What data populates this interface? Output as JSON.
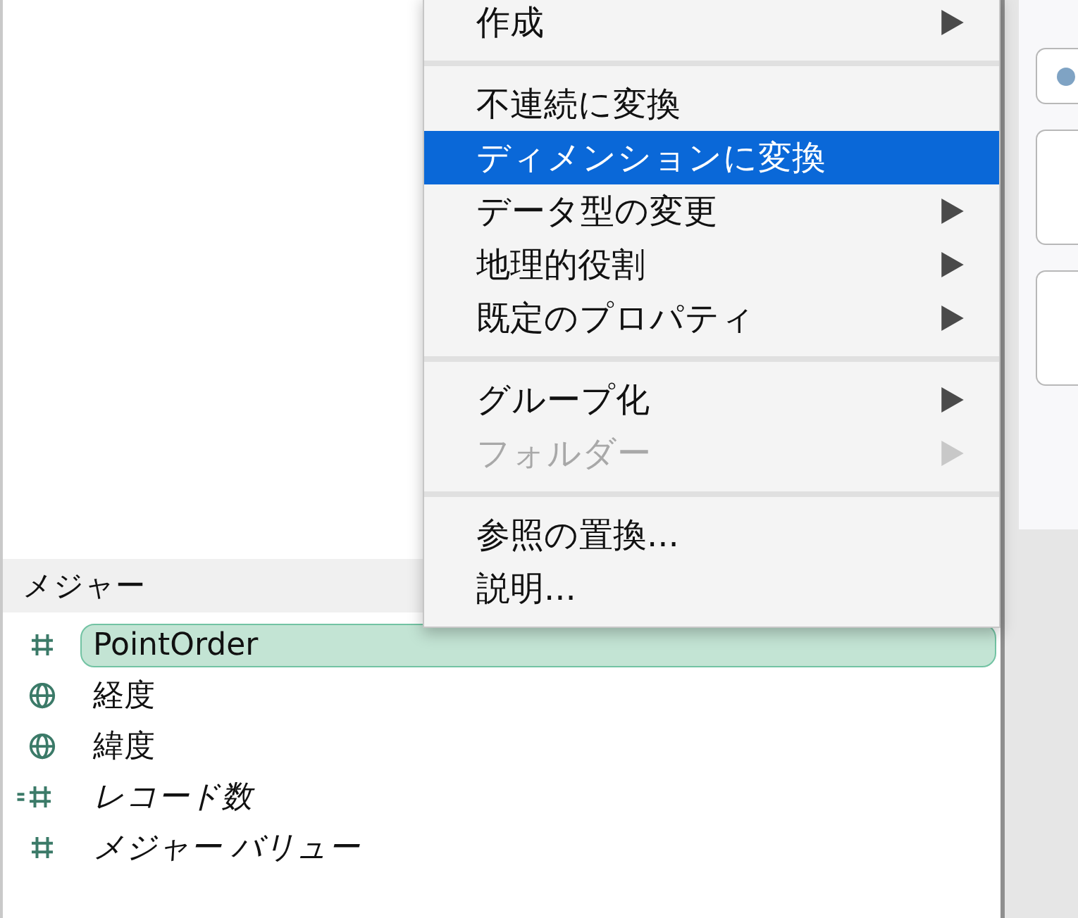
{
  "menu": {
    "items": [
      {
        "kind": "item",
        "label": "作成",
        "submenu": true,
        "disabled": false,
        "selected": false
      },
      {
        "kind": "separator"
      },
      {
        "kind": "item",
        "label": "不連続に変換",
        "submenu": false,
        "disabled": false,
        "selected": false
      },
      {
        "kind": "item",
        "label": "ディメンションに変換",
        "submenu": false,
        "disabled": false,
        "selected": true
      },
      {
        "kind": "item",
        "label": "データ型の変更",
        "submenu": true,
        "disabled": false,
        "selected": false
      },
      {
        "kind": "item",
        "label": "地理的役割",
        "submenu": true,
        "disabled": false,
        "selected": false
      },
      {
        "kind": "item",
        "label": "既定のプロパティ",
        "submenu": true,
        "disabled": false,
        "selected": false
      },
      {
        "kind": "separator"
      },
      {
        "kind": "item",
        "label": "グループ化",
        "submenu": true,
        "disabled": false,
        "selected": false
      },
      {
        "kind": "item",
        "label": "フォルダー",
        "submenu": true,
        "disabled": true,
        "selected": false
      },
      {
        "kind": "separator"
      },
      {
        "kind": "item",
        "label": "参照の置換...",
        "submenu": false,
        "disabled": false,
        "selected": false
      },
      {
        "kind": "item",
        "label": "説明...",
        "submenu": false,
        "disabled": false,
        "selected": false
      }
    ]
  },
  "measures": {
    "title": "メジャー",
    "fields": [
      {
        "label": "PointOrder",
        "kind": "number",
        "generated": false,
        "selected": true
      },
      {
        "label": "経度",
        "kind": "globe",
        "generated": false,
        "selected": false
      },
      {
        "label": "緯度",
        "kind": "globe",
        "generated": false,
        "selected": false
      },
      {
        "label": "レコード数",
        "kind": "count",
        "generated": true,
        "selected": false
      },
      {
        "label": "メジャー バリュー",
        "kind": "number",
        "generated": true,
        "selected": false
      }
    ]
  }
}
